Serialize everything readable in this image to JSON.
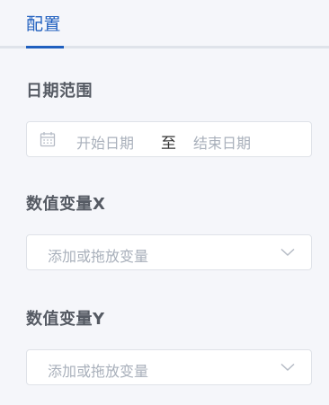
{
  "tabs": [
    {
      "label": "配置"
    }
  ],
  "date_range": {
    "label": "日期范围",
    "start_placeholder": "开始日期",
    "separator": "至",
    "end_placeholder": "结束日期"
  },
  "variable_x": {
    "label": "数值变量X",
    "placeholder": "添加或拖放变量"
  },
  "variable_y": {
    "label": "数值变量Y",
    "placeholder": "添加或拖放变量"
  },
  "colors": {
    "accent": "#1f5fbf",
    "background": "#f5f6fa",
    "placeholder": "#a9b0bb",
    "border": "#dfe2e8"
  },
  "icons": [
    "calendar-icon",
    "chevron-down-icon"
  ]
}
